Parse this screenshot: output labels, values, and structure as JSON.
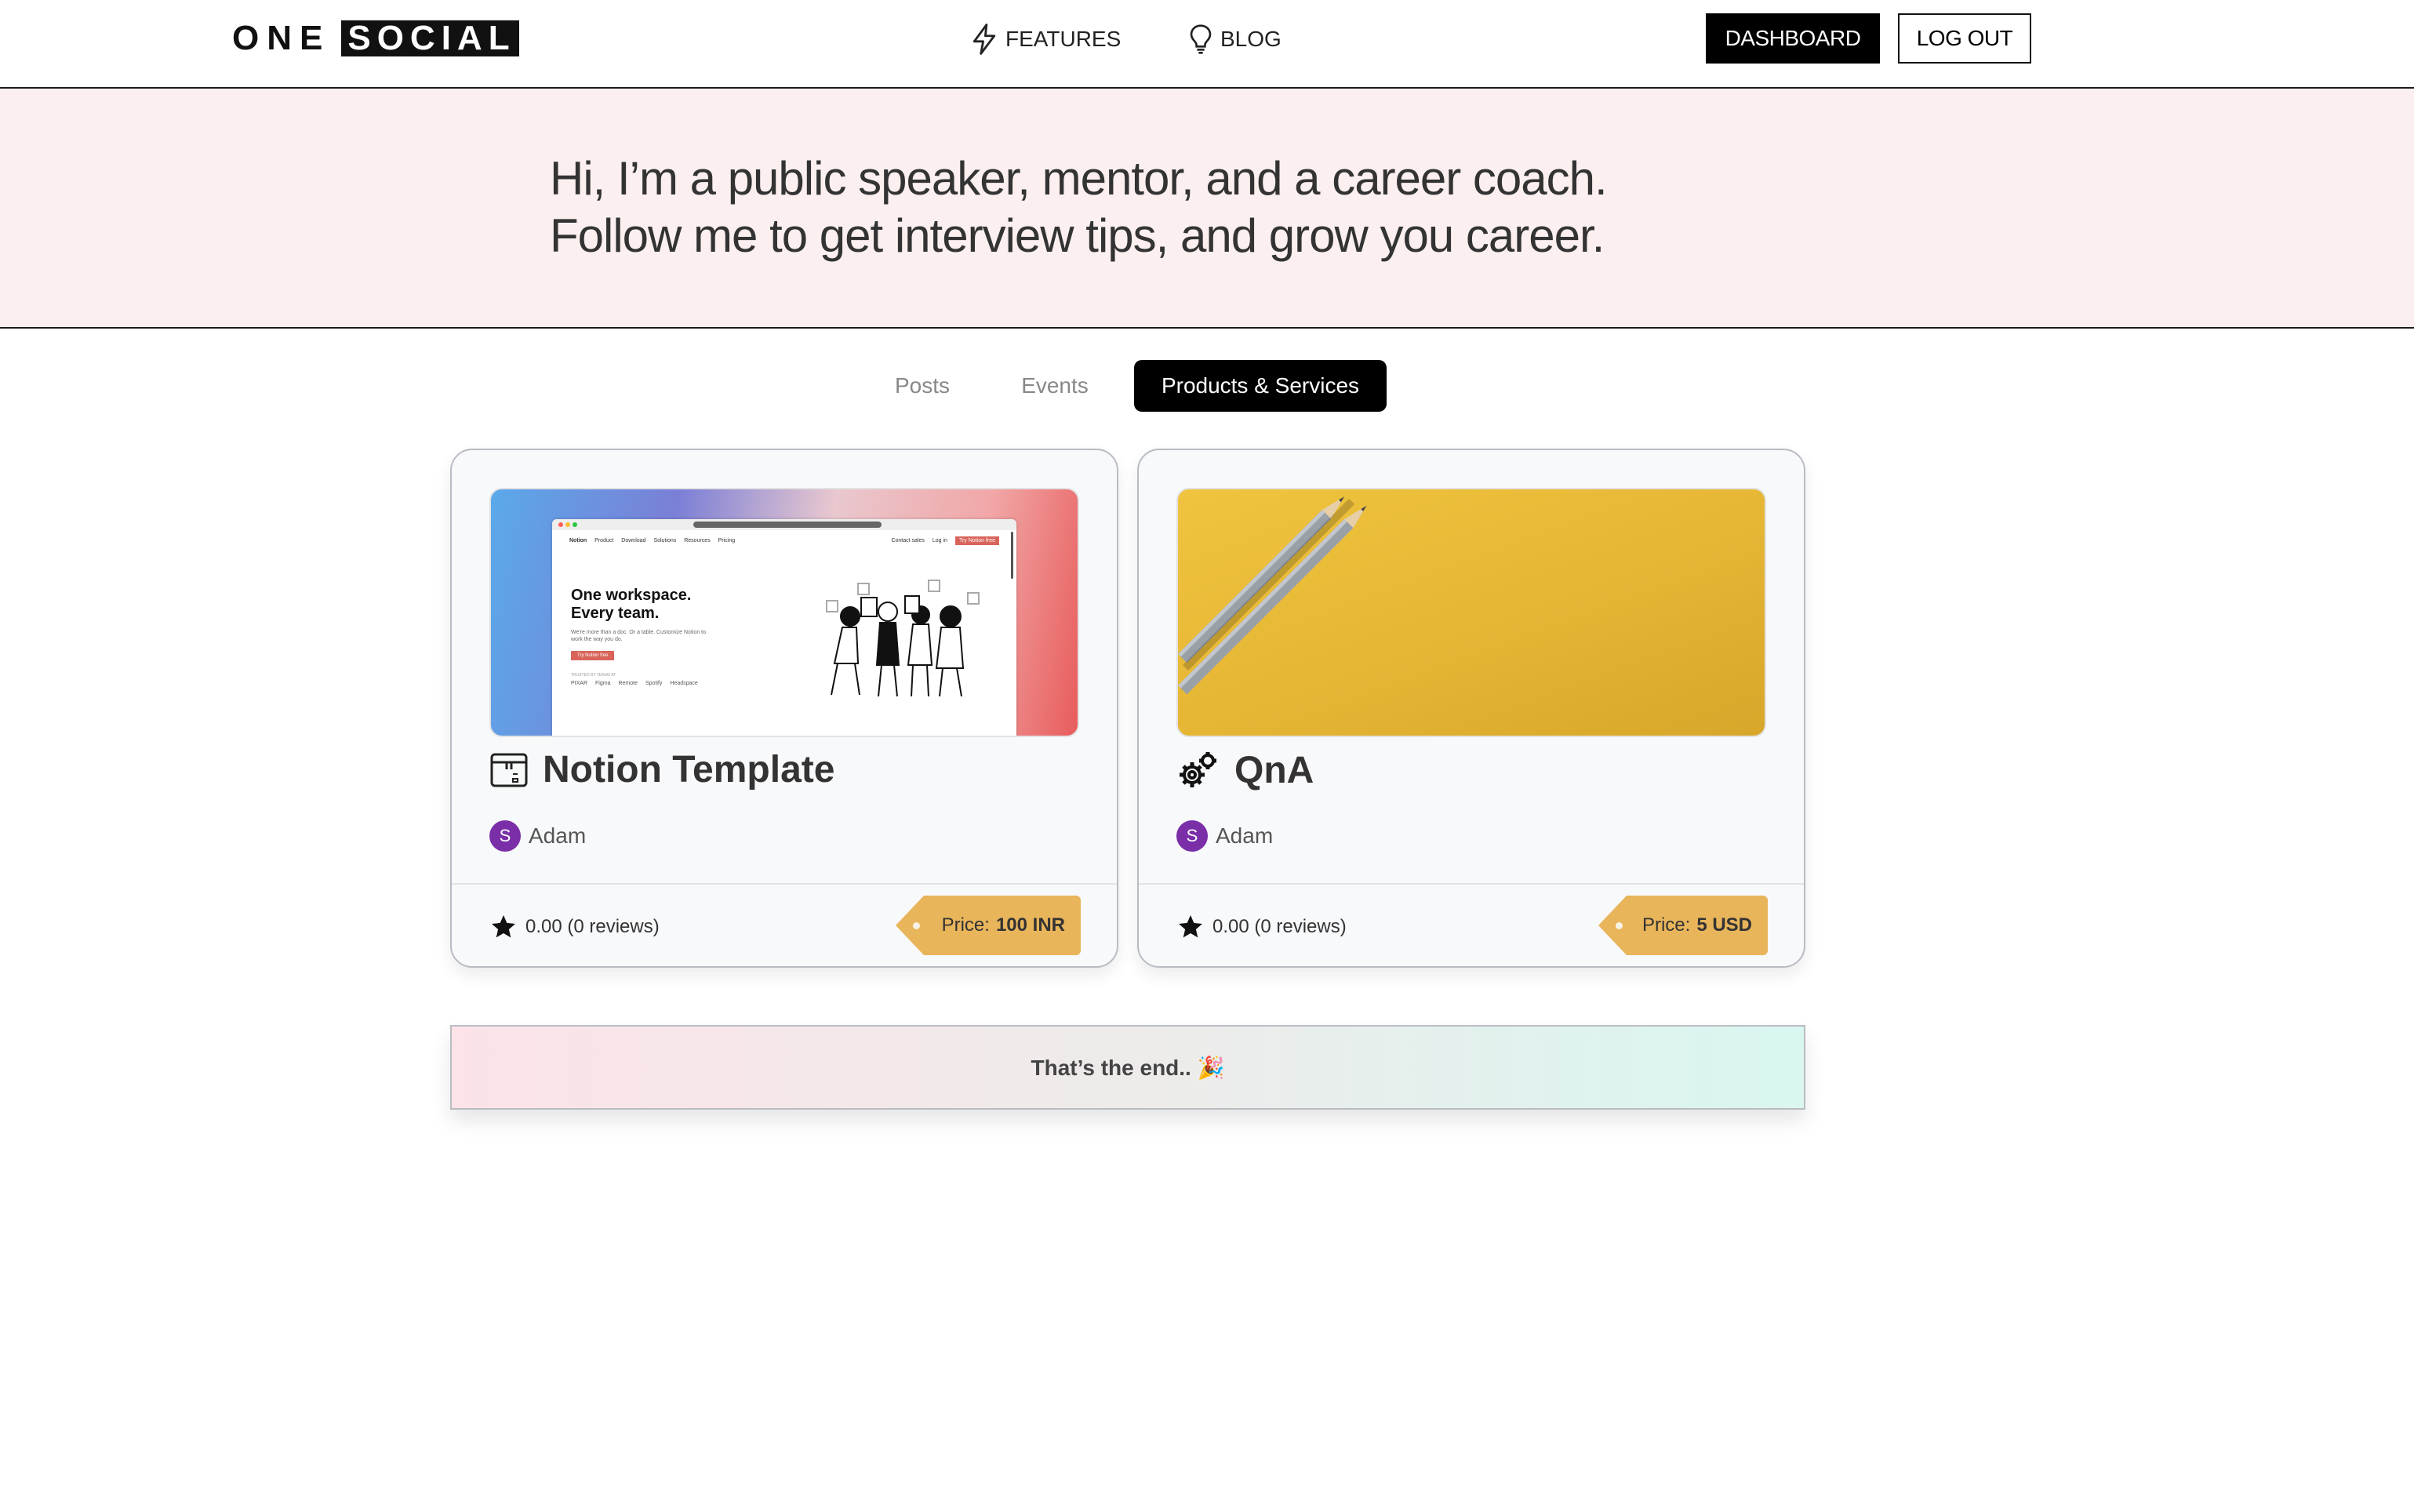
{
  "header": {
    "logo_one": "ONE",
    "logo_social": "SOCIAL",
    "nav": [
      {
        "label": "FEATURES",
        "icon": "lightning-icon"
      },
      {
        "label": "BLOG",
        "icon": "lightbulb-icon"
      }
    ],
    "dashboard_label": "DASHBOARD",
    "logout_label": "LOG OUT"
  },
  "hero": {
    "line1": "Hi, I’m a public speaker, mentor, and a career coach.",
    "line2": "Follow me to get interview tips, and grow you career."
  },
  "tabs": [
    {
      "label": "Posts",
      "active": false
    },
    {
      "label": "Events",
      "active": false
    },
    {
      "label": "Products & Services",
      "active": true
    }
  ],
  "cards": [
    {
      "title": "Notion Template",
      "icon": "package-icon",
      "author_initial": "S",
      "author": "Adam",
      "rating": "0.00 (0 reviews)",
      "price_label": "Price:",
      "price_value": "100 INR",
      "thumb": {
        "headline1": "One workspace.",
        "headline2": "Every team.",
        "brand": "Notion",
        "menu": [
          "Product",
          "Download",
          "Solutions",
          "Resources",
          "Pricing"
        ],
        "contact": "Contact sales",
        "login": "Log in",
        "cta": "Try Notion free",
        "sub": "We're more than a doc. Or a table. Customize Notion to work the way you do.",
        "trusted": "TRUSTED BY TEAMS AT",
        "logos": [
          "PIXAR",
          "Figma",
          "Remote",
          "Spotify",
          "Headspace"
        ]
      }
    },
    {
      "title": "QnA",
      "icon": "gears-icon",
      "author_initial": "S",
      "author": "Adam",
      "rating": "0.00 (0 reviews)",
      "price_label": "Price:",
      "price_value": "5 USD"
    }
  ],
  "end_banner": "That’s the end.. 🎉",
  "colors": {
    "hero_bg": "#fbf0ef",
    "price_tag": "#e9b55b",
    "avatar": "#7a2ea8",
    "active_tab": "#000000"
  }
}
